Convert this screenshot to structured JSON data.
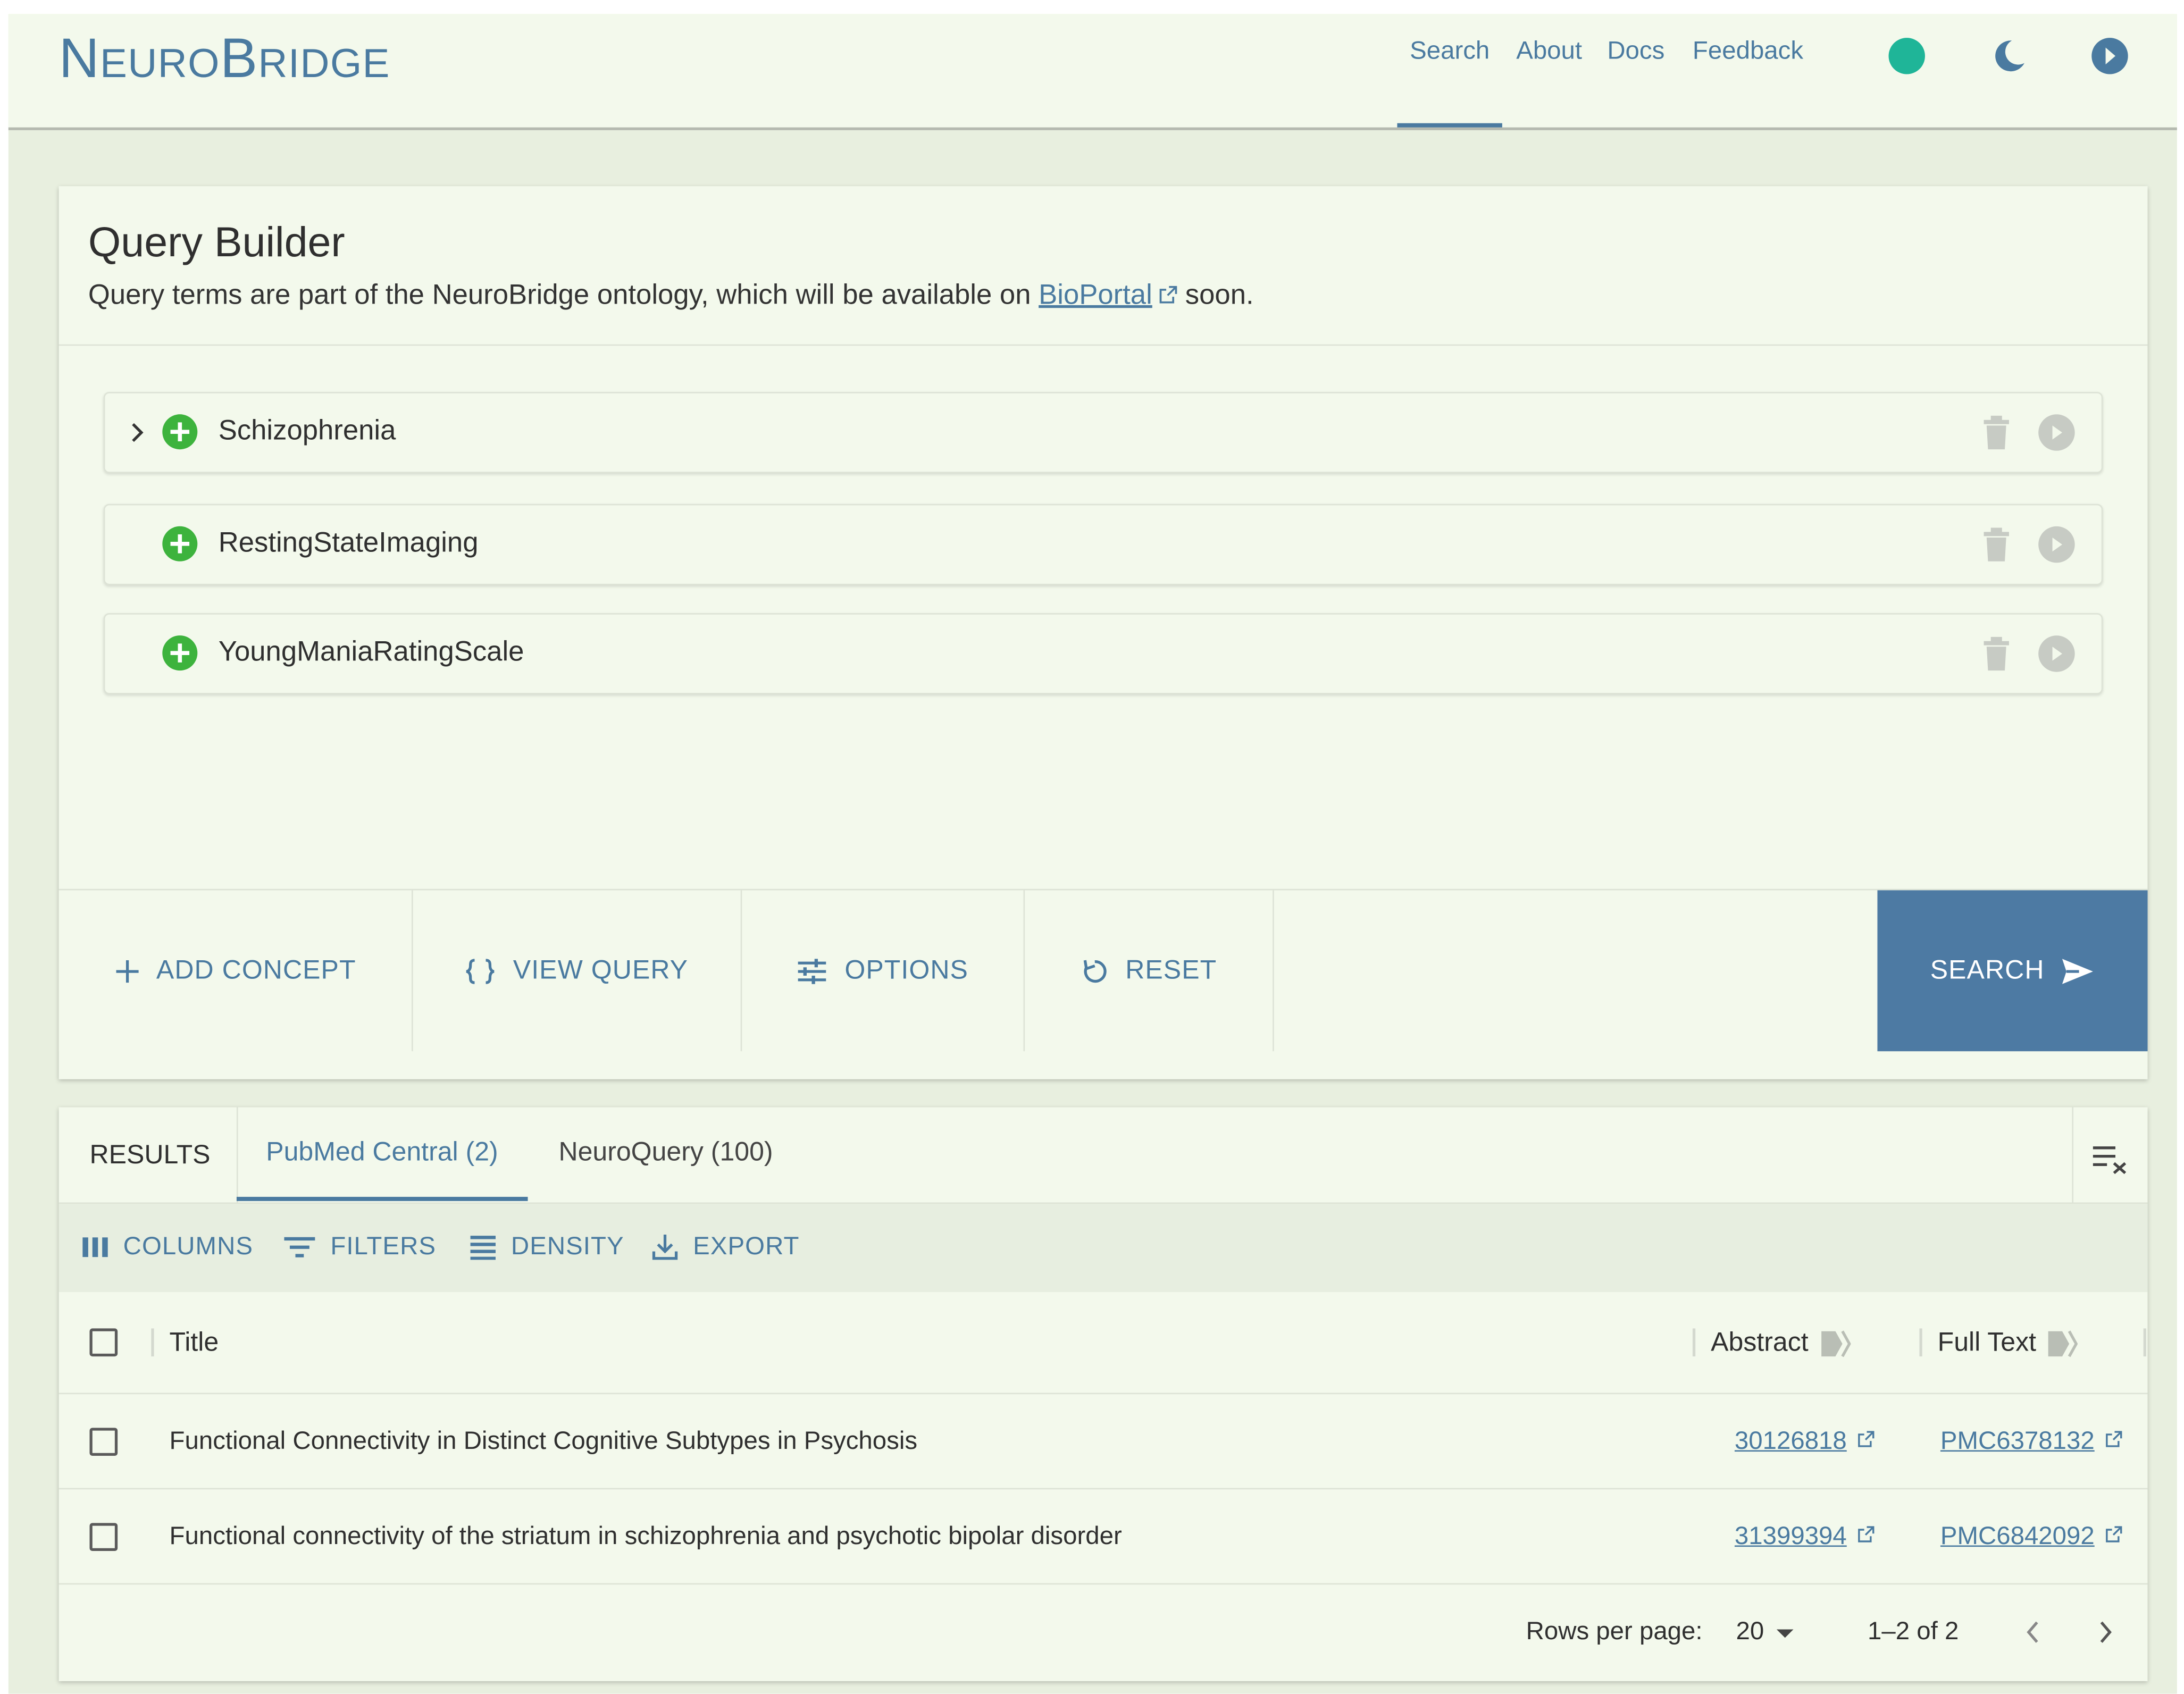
{
  "header": {
    "logo_first": "N",
    "logo_rest_1": "EURO",
    "logo_mid": "B",
    "logo_rest_2": "RIDGE",
    "nav": [
      "Search",
      "About",
      "Docs",
      "Feedback"
    ],
    "active_nav": "Search",
    "icons": [
      "status-dot-icon",
      "dark-mode-moon-icon",
      "menu-arrow-icon"
    ],
    "status_color": "#1fb598"
  },
  "query_builder": {
    "title": "Query Builder",
    "subtitle_pre": "Query terms are part of the NeuroBridge ontology, which will be available on ",
    "subtitle_link": "BioPortal",
    "subtitle_post": " soon.",
    "concepts": [
      {
        "label": "Schizophrenia",
        "expandable": true
      },
      {
        "label": "RestingStateImaging",
        "expandable": false
      },
      {
        "label": "YoungManiaRatingScale",
        "expandable": false
      }
    ],
    "actions": {
      "add_concept": "ADD CONCEPT",
      "view_query": "VIEW QUERY",
      "options": "OPTIONS",
      "reset": "RESET",
      "search": "SEARCH"
    }
  },
  "results": {
    "label": "RESULTS",
    "tabs": [
      "PubMed Central (2)",
      "NeuroQuery (100)"
    ],
    "active_tab": "PubMed Central (2)",
    "toolbar": {
      "columns": "COLUMNS",
      "filters": "FILTERS",
      "density": "DENSITY",
      "export": "EXPORT"
    },
    "columns": {
      "title": "Title",
      "abstract": "Abstract",
      "full_text": "Full Text"
    },
    "rows": [
      {
        "title": "Functional Connectivity in Distinct Cognitive Subtypes in Psychosis",
        "abstract": "30126818",
        "full_text": "PMC6378132"
      },
      {
        "title": "Functional connectivity of the striatum in schizophrenia and psychotic bipolar disorder",
        "abstract": "31399394",
        "full_text": "PMC6842092"
      }
    ],
    "pagination": {
      "rows_per_page_label": "Rows per page:",
      "rows_per_page": "20",
      "range": "1–2 of 2"
    }
  },
  "colors": {
    "accent": "#4a7aa0",
    "search_button": "#4d7aa3",
    "add_icon": "#3db33d",
    "page_bg": "#e8efdf",
    "card_bg": "#f3f9ec"
  }
}
